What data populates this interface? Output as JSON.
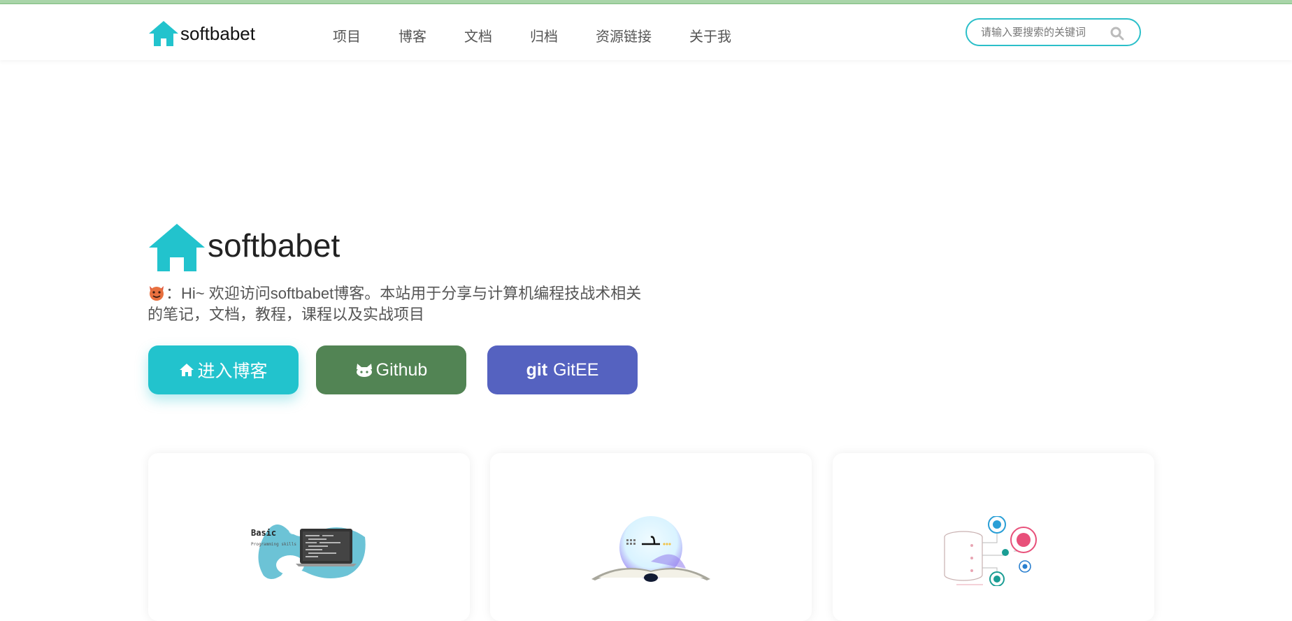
{
  "header": {
    "logo_text": "softbabet",
    "nav": [
      "项目",
      "博客",
      "文档",
      "归档",
      "资源链接",
      "关于我"
    ],
    "search_placeholder": "请输入要搜索的关键词"
  },
  "hero": {
    "name": "softbabet",
    "intro": "：Hi~ 欢迎访问softbabet博客。本站用于分享与计算机编程技战术相关的笔记，文档，教程，课程以及实战项目",
    "buttons": {
      "blog": "进入博客",
      "github": "Github",
      "gitee": "GitEE",
      "gitee_prefix": "git"
    }
  },
  "cards": [
    {
      "icon": "basic-programming-illustration",
      "img_title": "Basic",
      "img_subtitle": "Programming skills"
    },
    {
      "icon": "open-book-illustration"
    },
    {
      "icon": "database-gears-illustration"
    }
  ],
  "colors": {
    "accent": "#22c3cd",
    "github": "#528454",
    "gitee": "#5562c0"
  }
}
